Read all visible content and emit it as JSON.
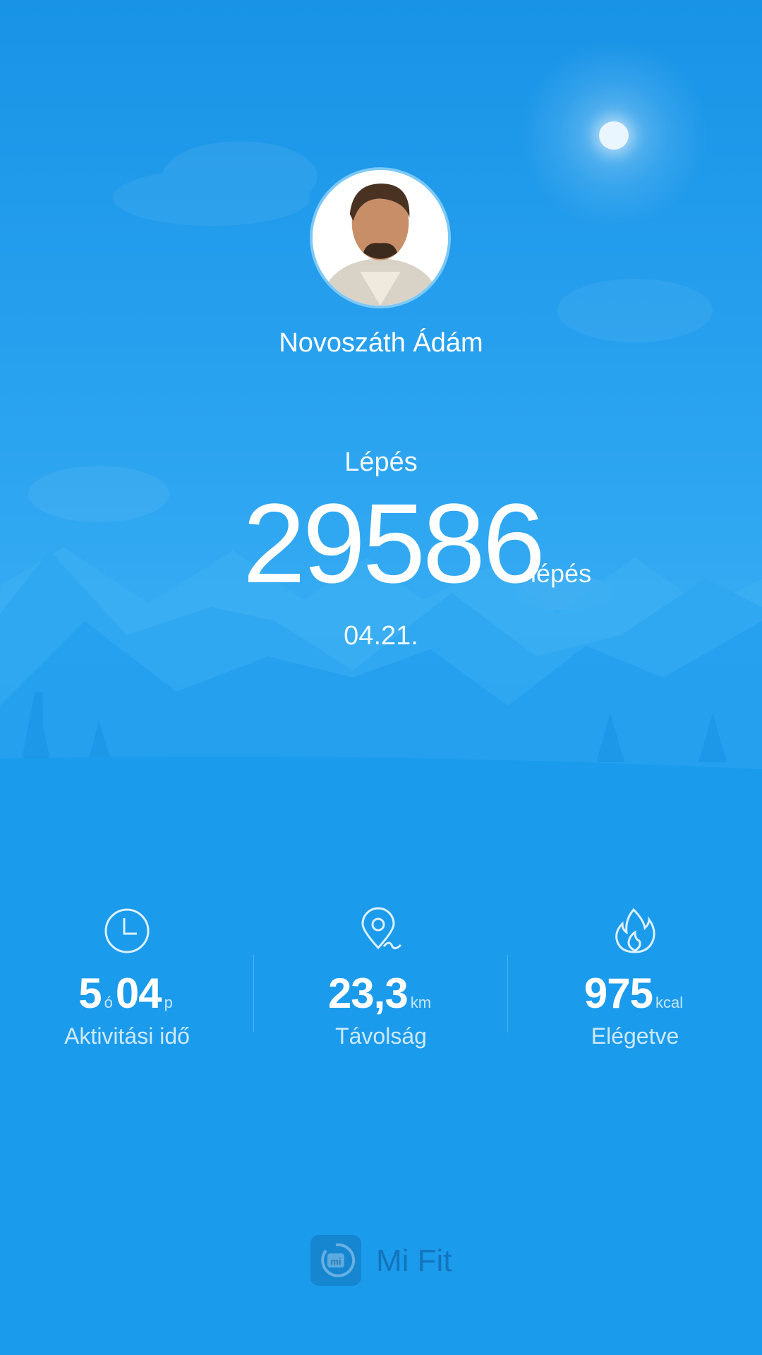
{
  "profile": {
    "name": "Novoszáth Ádám",
    "avatar_alt": "user avatar"
  },
  "steps": {
    "label": "Lépés",
    "value": "29586",
    "unit": "lépés",
    "date": "04.21."
  },
  "stats": {
    "activity": {
      "hours": "5",
      "hours_unit": "ó",
      "minutes": "04",
      "minutes_unit": "p",
      "label": "Aktivitási idő",
      "icon": "clock-icon"
    },
    "distance": {
      "value": "23,3",
      "unit": "km",
      "label": "Távolság",
      "icon": "location-pin-icon"
    },
    "calories": {
      "value": "975",
      "unit": "kcal",
      "label": "Elégetve",
      "icon": "flame-icon"
    }
  },
  "brand": {
    "name": "Mi Fit",
    "logo_text": "mi"
  },
  "colors": {
    "background": "#1b9bec",
    "sky_top": "#1893e6",
    "mountains": "#3fb2f3",
    "text": "#ffffff"
  }
}
